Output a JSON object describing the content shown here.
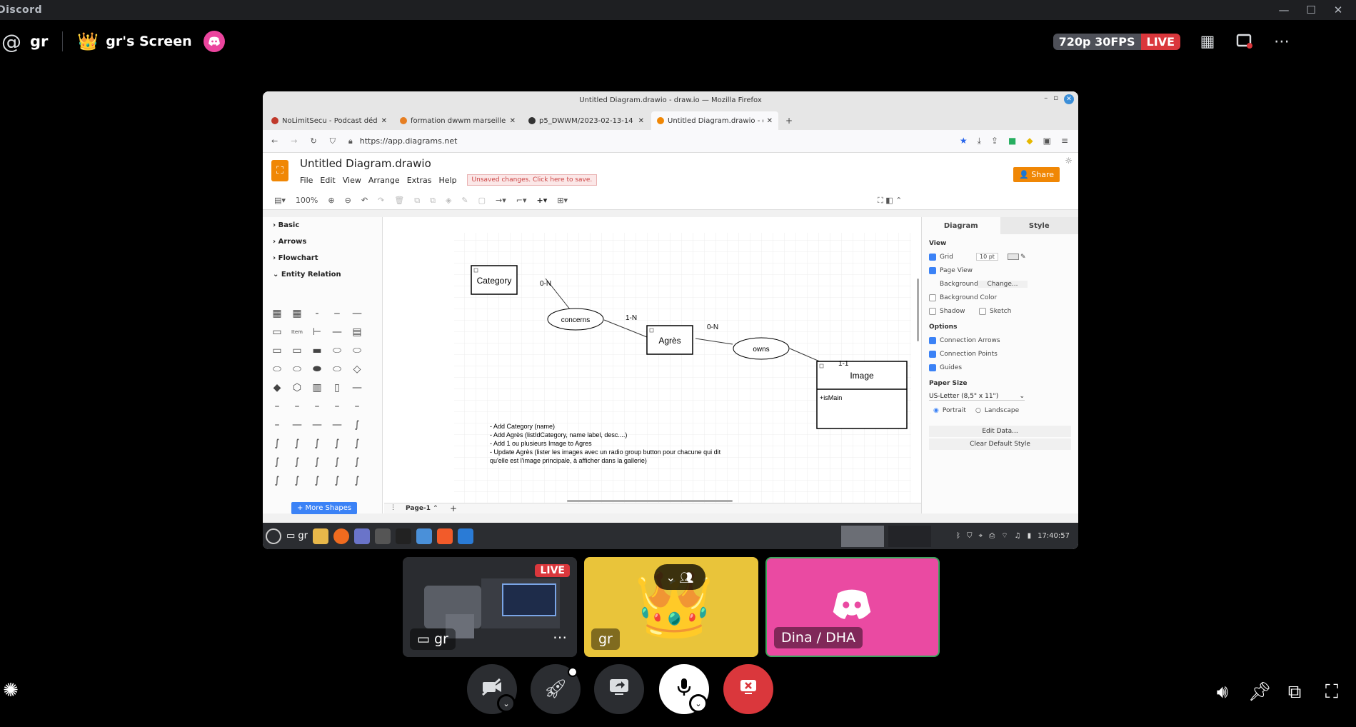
{
  "window": {
    "title": "Discord"
  },
  "header": {
    "username": "gr",
    "screen_title": "gr's Screen",
    "quality": "720p 30FPS",
    "live": "LIVE"
  },
  "firefox": {
    "title": "Untitled Diagram.drawio - draw.io — Mozilla Firefox",
    "tabs": [
      {
        "label": "NoLimitSecu - Podcast dédi",
        "color": "#c0392b"
      },
      {
        "label": "formation dwwm marseille",
        "color": "#e67e22"
      },
      {
        "label": "p5_DWWM/2023-02-13-14",
        "color": "#333333"
      },
      {
        "label": "Untitled Diagram.drawio - d",
        "color": "#f08705"
      }
    ],
    "url": "https://app.diagrams.net"
  },
  "drawio": {
    "filename": "Untitled Diagram.drawio",
    "menu": [
      "File",
      "Edit",
      "View",
      "Arrange",
      "Extras",
      "Help"
    ],
    "unsaved": "Unsaved changes. Click here to save.",
    "share": "Share",
    "zoom": "100%",
    "sidebar_sections": [
      "Basic",
      "Arrows",
      "Flowchart",
      "Entity Relation"
    ],
    "more_shapes": "+ More Shapes",
    "page_tab": "Page-1",
    "diagram": {
      "entities": [
        "Category",
        "Agrès",
        "Image"
      ],
      "relations": [
        "concerns",
        "owns"
      ],
      "cardinalities": [
        "0-N",
        "1-N",
        "0-N",
        "1-1"
      ],
      "attribute": "+isMain",
      "notes": [
        "- Add Category (name)",
        "- Add Agrès (listIdCategory, name label, desc....)",
        "- Add 1 ou plusieurs Image to Agres",
        "- Update Agrès (lister les images avec un radio group button pour chacune qui dit",
        "qu'elle est l'image principale, à afficher dans la gallerie)"
      ]
    },
    "panel": {
      "tab_diagram": "Diagram",
      "tab_style": "Style",
      "view_header": "View",
      "grid": "Grid",
      "grid_size": "10 pt",
      "page_view": "Page View",
      "background": "Background",
      "change": "Change...",
      "background_color": "Background Color",
      "shadow": "Shadow",
      "sketch": "Sketch",
      "options_header": "Options",
      "connection_arrows": "Connection Arrows",
      "connection_points": "Connection Points",
      "guides": "Guides",
      "paper_size_header": "Paper Size",
      "paper_size": "US-Letter (8,5\" x 11\")",
      "portrait": "Portrait",
      "landscape": "Landscape",
      "edit_data": "Edit Data...",
      "clear_style": "Clear Default Style"
    }
  },
  "taskbar": {
    "clock": "17:40:57",
    "user": "gr"
  },
  "tiles": {
    "screen_label": "gr",
    "screen_live": "LIVE",
    "user_label": "gr",
    "other_label": "Dina / DHA"
  },
  "colors": {
    "accent_live": "#da373c",
    "discord_pink": "#eb459e",
    "drawio_orange": "#f08705"
  }
}
